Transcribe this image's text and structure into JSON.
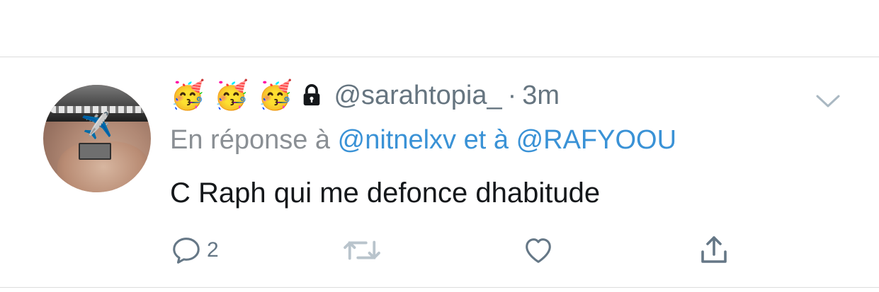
{
  "tweet": {
    "emojis": [
      "🥳",
      "🥳",
      "🥳"
    ],
    "handle": "@sarahtopia_",
    "separator": "·",
    "time": "3m",
    "reply": {
      "prefix": "En réponse à",
      "mention1": "@nitnelxv",
      "conjunction": "et à",
      "mention2": "@RAFYOOU"
    },
    "text": "C Raph qui me defonce dhabitude",
    "actions": {
      "reply_count": "2"
    }
  },
  "icons": {
    "protected": "lock-icon",
    "menu": "chevron-down-icon",
    "reply": "reply-icon",
    "retweet": "retweet-icon",
    "like": "heart-icon",
    "share": "share-icon"
  },
  "colors": {
    "mention": "#3a92d6",
    "secondary_text": "#657786",
    "primary_text": "#14171a"
  }
}
